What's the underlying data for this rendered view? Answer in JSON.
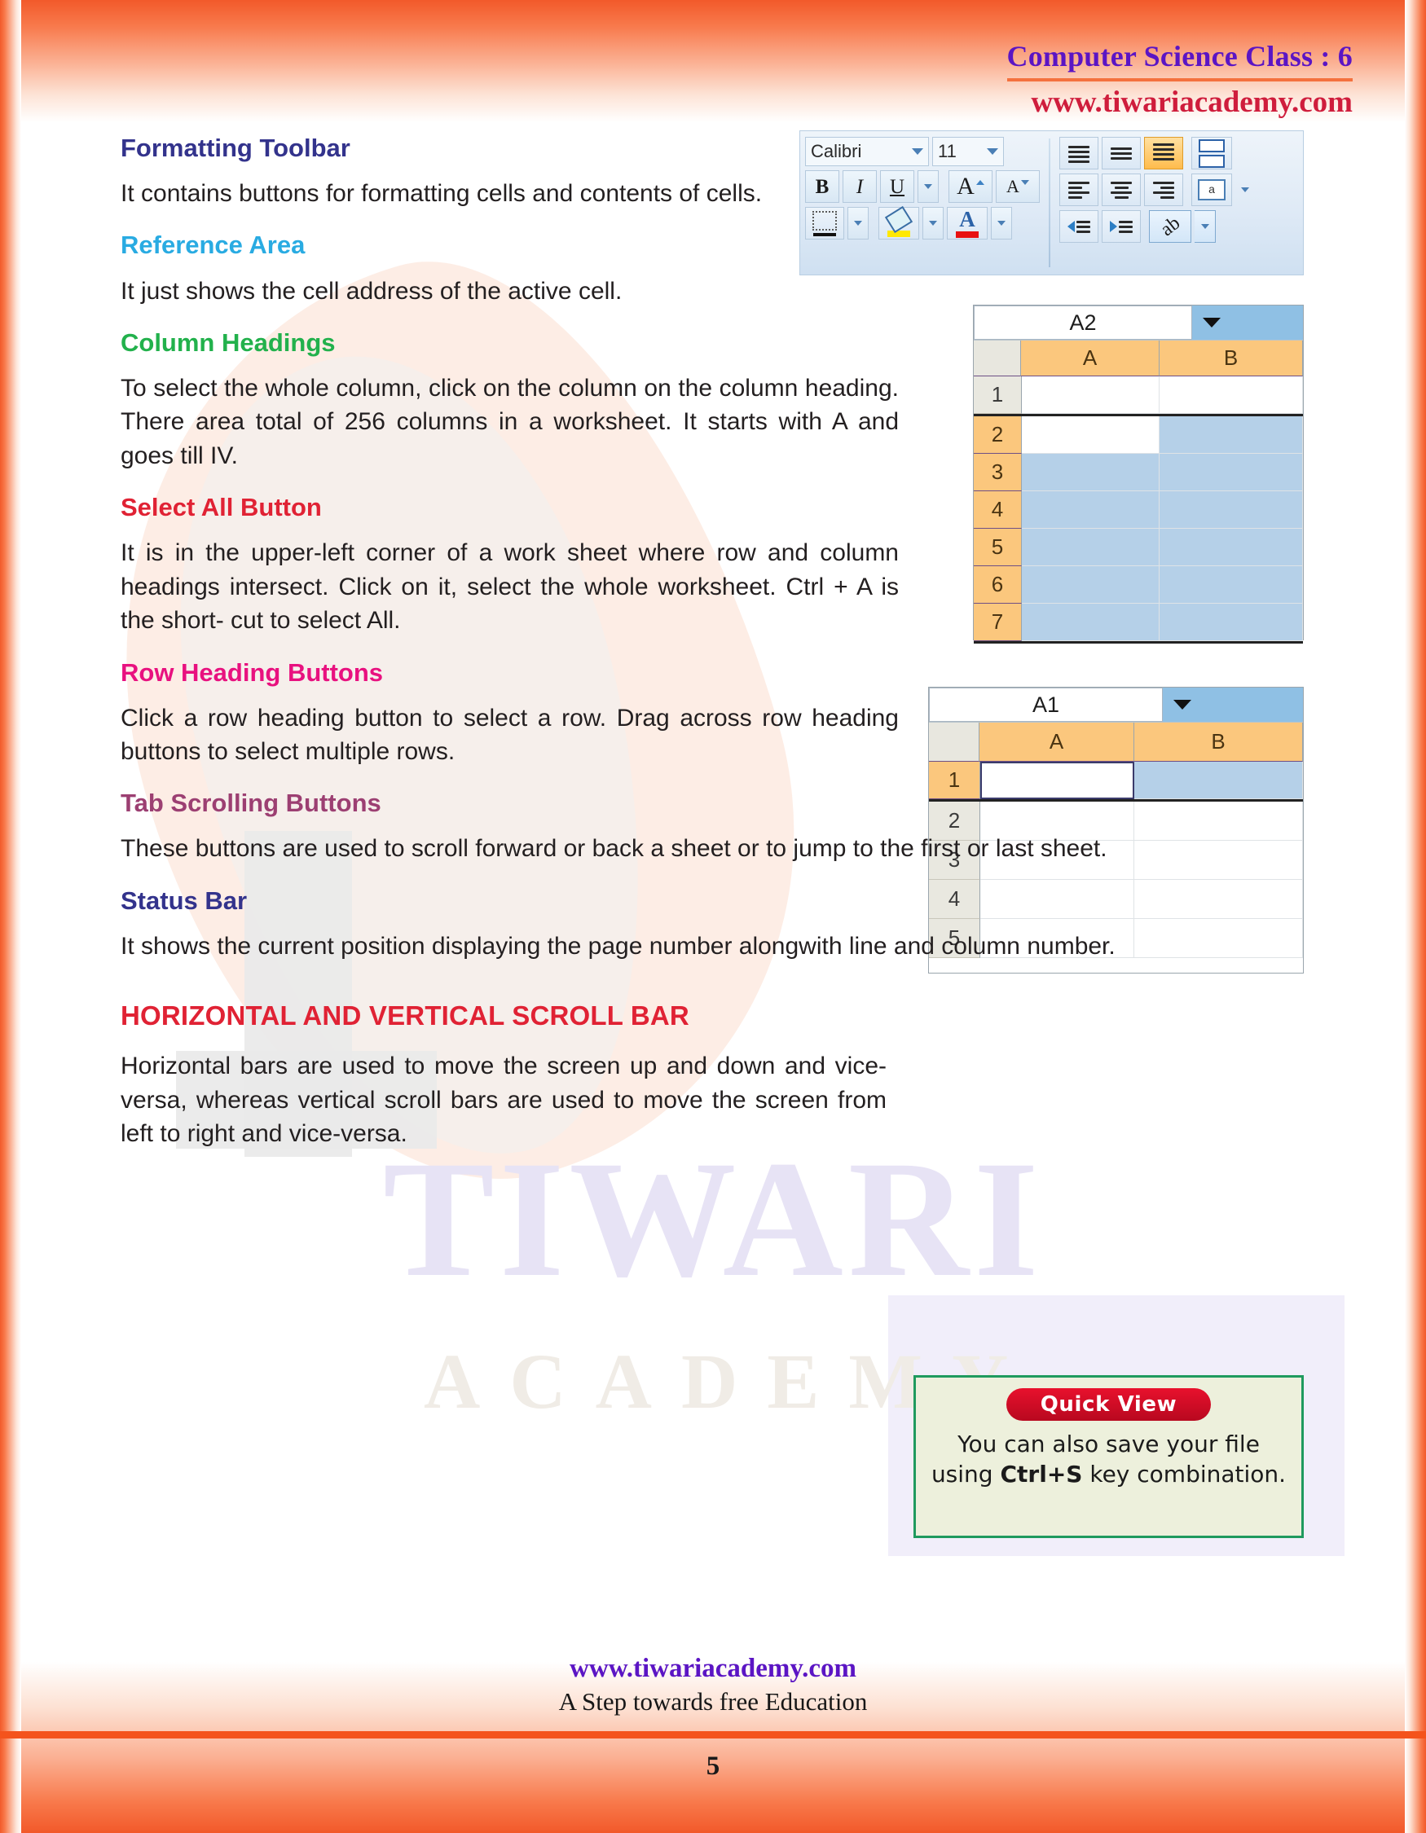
{
  "header": {
    "title": "Computer Science Class : 6",
    "url": "www.tiwariacademy.com"
  },
  "watermark": {
    "line1": "TIWARI",
    "line2": "ACADEMY"
  },
  "sections": [
    {
      "heading": "Formatting Toolbar",
      "color": "#33338c",
      "body": "It contains buttons for formatting cells and contents of cells."
    },
    {
      "heading": "Reference Area",
      "color": "#29abe2",
      "body": "It just shows the cell address of the active cell."
    },
    {
      "heading": "Column Headings",
      "color": "#22b14c",
      "body": "To select the whole column, click on the column on the column heading. There area total of 256 columns in a worksheet. It starts with A and goes till IV."
    },
    {
      "heading": "Select All Button",
      "color": "#e02234",
      "body": "It is in the upper-left corner of a work sheet where row and column headings intersect. Click on it, select the whole worksheet. Ctrl + A is the short- cut to select All."
    },
    {
      "heading": "Row Heading Buttons",
      "color": "#e8117f",
      "body": "Click a row heading button to select a row. Drag across row heading buttons to select multiple rows."
    },
    {
      "heading": "Tab Scrolling Buttons",
      "color": "#9c3f72",
      "body": "These buttons are used to scroll forward or back a sheet or to jump to the first or last sheet."
    },
    {
      "heading": "Status Bar",
      "color": "#33338c",
      "body": "It shows the current position displaying the page number alongwith line and column number."
    },
    {
      "heading": "HORIZONTAL AND VERTICAL SCROLL BAR",
      "color": "#e02234",
      "body": "Horizontal bars are used to move the screen up and down and vice-versa, whereas vertical scroll bars are used to move the screen from left to right and vice-versa."
    }
  ],
  "toolbar": {
    "font_name": "Calibri",
    "font_size": "11",
    "bold": "B",
    "italic": "I",
    "underline": "U",
    "grow_font": "A",
    "shrink_font": "A",
    "font_color_letter": "A"
  },
  "sheet_a2": {
    "name_box": "A2",
    "columns": [
      "A",
      "B"
    ],
    "rows": [
      "1",
      "2",
      "3",
      "4",
      "5",
      "6",
      "7"
    ],
    "selected_rows": [
      "2",
      "3",
      "4",
      "5",
      "6",
      "7"
    ],
    "active_cell": "A2"
  },
  "sheet_a1": {
    "name_box": "A1",
    "columns": [
      "A",
      "B"
    ],
    "rows": [
      "1",
      "2",
      "3",
      "4",
      "5"
    ],
    "selected_rows": [
      "1"
    ],
    "active_cell": "A1"
  },
  "quick_view": {
    "badge": "Quick View",
    "text_before": "You can also save your file using ",
    "shortcut": "Ctrl+S",
    "text_after": " key combination."
  },
  "footer": {
    "url": "www.tiwariacademy.com",
    "tagline": "A Step towards free Education",
    "page_number": "5"
  }
}
